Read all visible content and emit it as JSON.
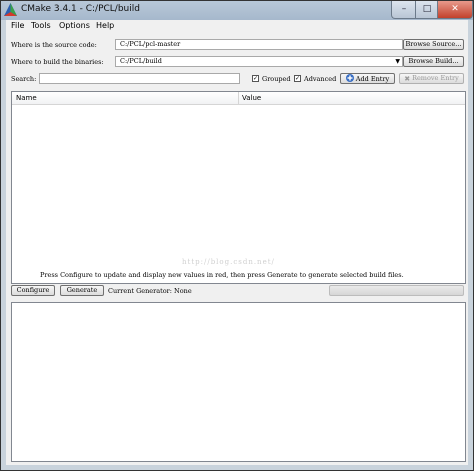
{
  "window": {
    "title": "CMake 3.4.1 - C:/PCL/build"
  },
  "menu": {
    "items": [
      "File",
      "Tools",
      "Options",
      "Help"
    ]
  },
  "source": {
    "label": "Where is the source code:",
    "value": "C:/PCL/pcl-master",
    "browse_label": "Browse Source..."
  },
  "build": {
    "label": "Where to build the binaries:",
    "value": "C:/PCL/build",
    "browse_label": "Browse Build..."
  },
  "search": {
    "label": "Search:",
    "value": "",
    "grouped_label": "Grouped",
    "advanced_label": "Advanced",
    "add_entry_label": "Add Entry",
    "remove_entry_label": "Remove Entry"
  },
  "tree": {
    "columns": [
      "Name",
      "Value"
    ],
    "watermark": "http://blog.csdn.net/"
  },
  "status": {
    "message": "Press Configure to update and display new values in red, then press Generate to generate selected build files.",
    "configure_label": "Configure",
    "generate_label": "Generate",
    "generator_text": "Current Generator: None"
  },
  "colors": {
    "title_bar": "#a6b8cc",
    "close_button": "#c2412c",
    "background": "#f0f0f0"
  }
}
